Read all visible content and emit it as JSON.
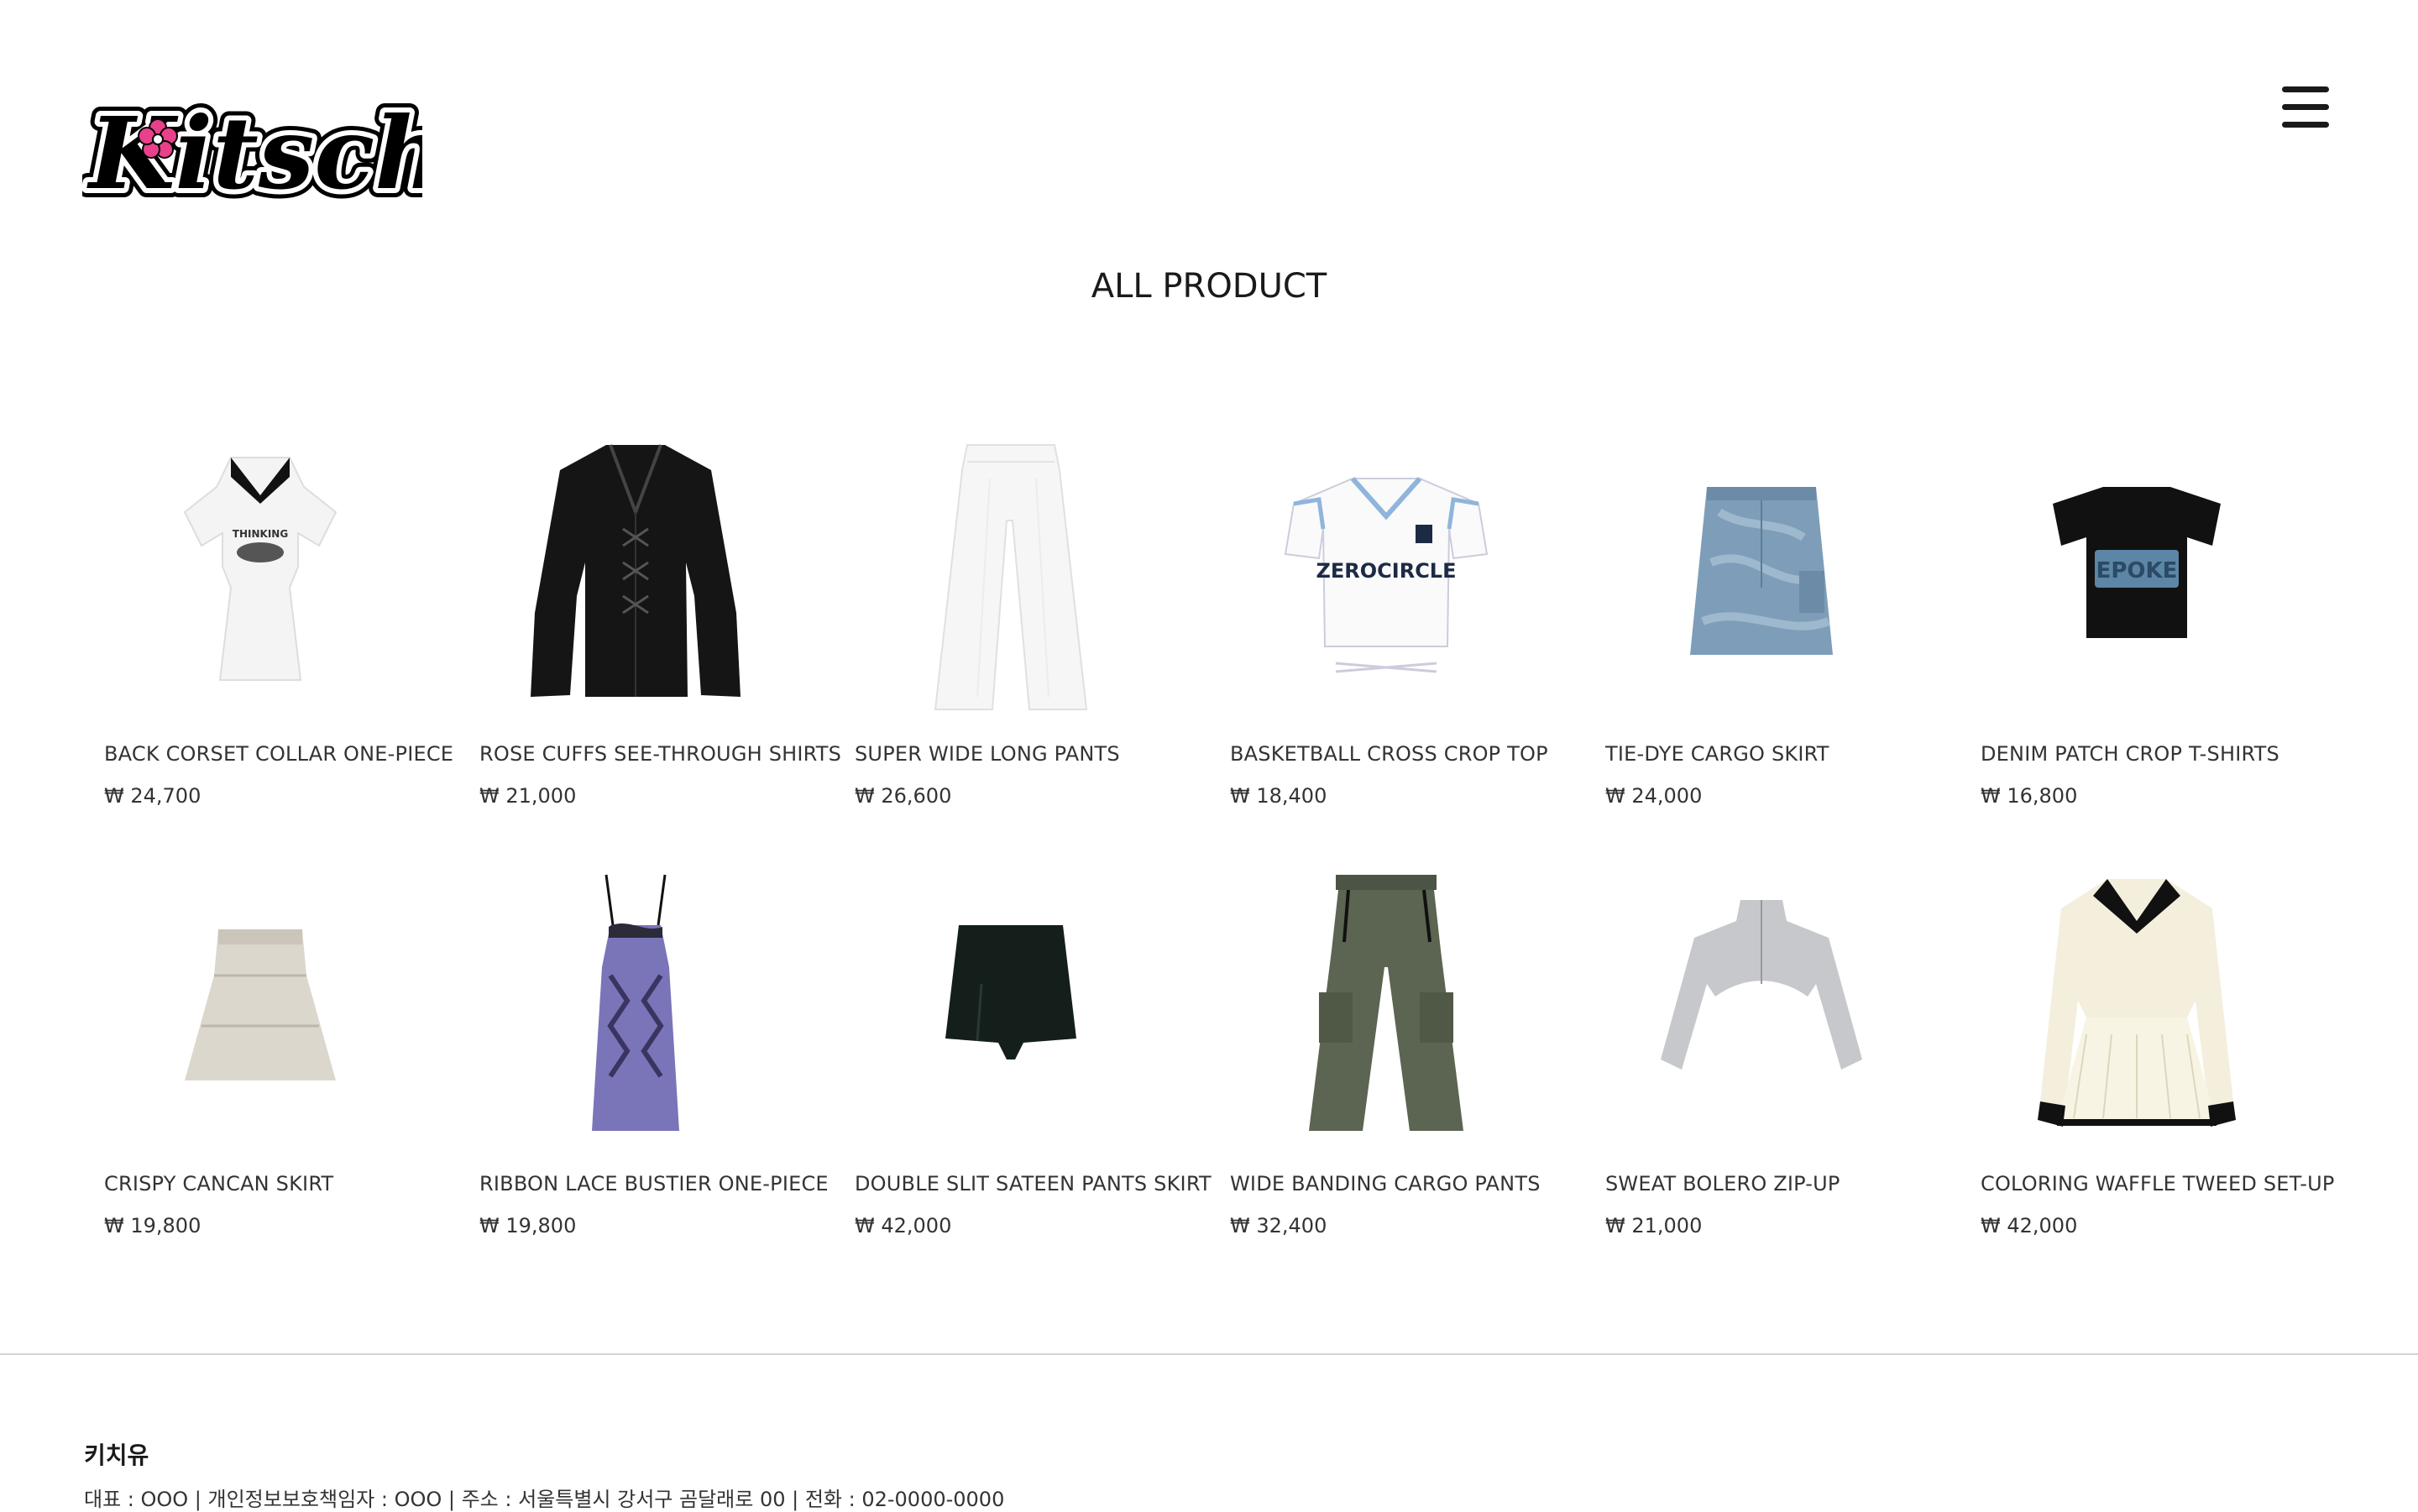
{
  "brand": {
    "logo_text": "KitschÜ",
    "logo_accent": "#e8408a"
  },
  "header": {
    "menu_icon": "hamburger-menu-icon"
  },
  "page": {
    "title": "ALL PRODUCT"
  },
  "products": [
    {
      "name": "BACK CORSET COLLAR ONE-PIECE",
      "price": "₩ 24,700"
    },
    {
      "name": "ROSE CUFFS SEE-THROUGH SHIRTS",
      "price": "₩ 21,000"
    },
    {
      "name": "SUPER WIDE LONG PANTS",
      "price": "₩ 26,600"
    },
    {
      "name": "BASKETBALL CROSS CROP TOP",
      "price": "₩ 18,400"
    },
    {
      "name": "TIE-DYE CARGO SKIRT",
      "price": "₩ 24,000"
    },
    {
      "name": "DENIM PATCH CROP T-SHIRTS",
      "price": "₩ 16,800"
    },
    {
      "name": "CRISPY CANCAN SKIRT",
      "price": "₩ 19,800"
    },
    {
      "name": "RIBBON LACE BUSTIER ONE-PIECE",
      "price": "₩ 19,800"
    },
    {
      "name": "DOUBLE SLIT SATEEN PANTS SKIRT",
      "price": "₩ 42,000"
    },
    {
      "name": "WIDE BANDING CARGO PANTS",
      "price": "₩ 32,400"
    },
    {
      "name": "SWEAT BOLERO ZIP-UP",
      "price": "₩ 21,000"
    },
    {
      "name": "COLORING WAFFLE TWEED SET-UP",
      "price": "₩ 42,000"
    }
  ],
  "product_print_text": {
    "top_graphic": "THINKING",
    "jersey": "ZEROCIRCLE",
    "tshirt_patch": "EPOKE"
  },
  "footer": {
    "company": "키치유",
    "info": "대표 : OOO | 개인정보보호책임자 : OOO | 주소 : 서울특별시 강서구 곰달래로 00 | 전화 : 02-0000-0000"
  }
}
